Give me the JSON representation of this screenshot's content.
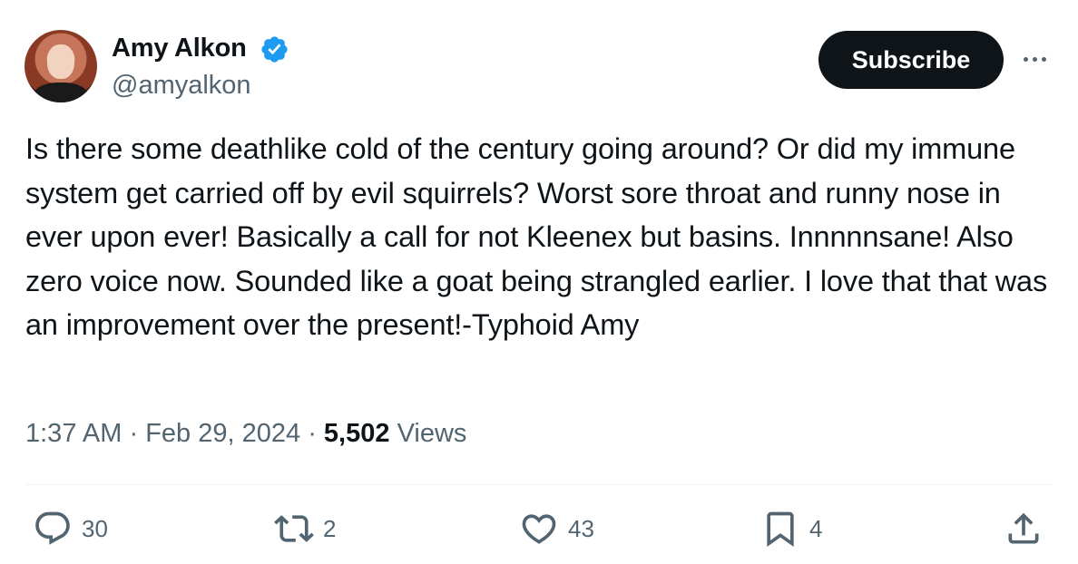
{
  "author": {
    "name": "Amy Alkon",
    "handle": "@amyalkon",
    "verified_color": "#1d9bf0"
  },
  "header": {
    "subscribe_label": "Subscribe",
    "more_icon": "more-horizontal-icon"
  },
  "tweet": {
    "text": "Is there some deathlike cold of the century going around? Or did my immune system get carried off by evil squirrels? Worst sore throat and runny nose in ever upon ever! Basically a call for not Kleenex but basins. Innnnnsane! Also zero voice now. Sounded like a goat being strangled earlier. I love that that was an improvement over the present!-Typhoid Amy"
  },
  "meta": {
    "time": "1:37 AM",
    "separator": "·",
    "date": "Feb 29, 2024",
    "views_count": "5,502",
    "views_label": "Views"
  },
  "actions": {
    "replies": {
      "icon": "reply-icon",
      "count": "30"
    },
    "reposts": {
      "icon": "repost-icon",
      "count": "2"
    },
    "likes": {
      "icon": "heart-icon",
      "count": "43"
    },
    "bookmarks": {
      "icon": "bookmark-icon",
      "count": "4"
    },
    "share": {
      "icon": "share-icon"
    }
  },
  "colors": {
    "text_primary": "#0f1419",
    "text_secondary": "#536471",
    "button_bg": "#0f1419"
  }
}
